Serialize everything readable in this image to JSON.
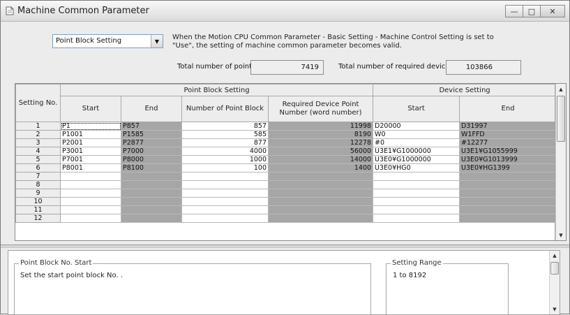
{
  "window": {
    "title": "Machine Common Parameter",
    "buttons": {
      "minimize": "—",
      "maximize": "□",
      "close": "✕"
    }
  },
  "controls": {
    "selected_option": "Point Block Setting",
    "info_text": "When the Motion CPU Common Parameter - Basic Setting - Machine Control Setting is set to \"Use\", the setting of machine common parameter becomes valid.",
    "total_point_block_label": "Total number of point block:",
    "total_point_block_value": "7419",
    "total_required_device_label": "Total number of required device:",
    "total_required_device_value": "103866"
  },
  "grid": {
    "headers": {
      "setting_no": "Setting No.",
      "point_block_group": "Point Block Setting",
      "device_group": "Device Setting",
      "start": "Start",
      "end": "End",
      "number_of_point_block": "Number of Point Block",
      "required_device": "Required Device Point Number (word number)",
      "device_start": "Start",
      "device_end": "End"
    },
    "rows": [
      {
        "no": "1",
        "start": "P1",
        "end": "P857",
        "count": "857",
        "required": "11998",
        "dev_start": "D20000",
        "dev_end": "D31997"
      },
      {
        "no": "2",
        "start": "P1001",
        "end": "P1585",
        "count": "585",
        "required": "8190",
        "dev_start": "W0",
        "dev_end": "W1FFD"
      },
      {
        "no": "3",
        "start": "P2001",
        "end": "P2877",
        "count": "877",
        "required": "12278",
        "dev_start": "#0",
        "dev_end": "#12277"
      },
      {
        "no": "4",
        "start": "P3001",
        "end": "P7000",
        "count": "4000",
        "required": "56000",
        "dev_start": "U3E1¥G1000000",
        "dev_end": "U3E1¥G1055999"
      },
      {
        "no": "5",
        "start": "P7001",
        "end": "P8000",
        "count": "1000",
        "required": "14000",
        "dev_start": "U3E0¥G1000000",
        "dev_end": "U3E0¥G1013999"
      },
      {
        "no": "6",
        "start": "P8001",
        "end": "P8100",
        "count": "100",
        "required": "1400",
        "dev_start": "U3E0¥HG0",
        "dev_end": "U3E0¥HG1399"
      },
      {
        "no": "7",
        "start": "",
        "end": "",
        "count": "",
        "required": "",
        "dev_start": "",
        "dev_end": ""
      },
      {
        "no": "8",
        "start": "",
        "end": "",
        "count": "",
        "required": "",
        "dev_start": "",
        "dev_end": ""
      },
      {
        "no": "9",
        "start": "",
        "end": "",
        "count": "",
        "required": "",
        "dev_start": "",
        "dev_end": ""
      },
      {
        "no": "10",
        "start": "",
        "end": "",
        "count": "",
        "required": "",
        "dev_start": "",
        "dev_end": ""
      },
      {
        "no": "11",
        "start": "",
        "end": "",
        "count": "",
        "required": "",
        "dev_start": "",
        "dev_end": ""
      },
      {
        "no": "12",
        "start": "",
        "end": "",
        "count": "",
        "required": "",
        "dev_start": "",
        "dev_end": ""
      }
    ]
  },
  "help": {
    "item_title": "Point Block No. Start",
    "item_description": "Set the start point block No. .",
    "range_title": "Setting Range",
    "range_value": "1 to 8192"
  },
  "colors": {
    "editable_cell": "#ffffff",
    "readonly_cell": "#a6a6a6",
    "header_bg": "#ededed"
  }
}
